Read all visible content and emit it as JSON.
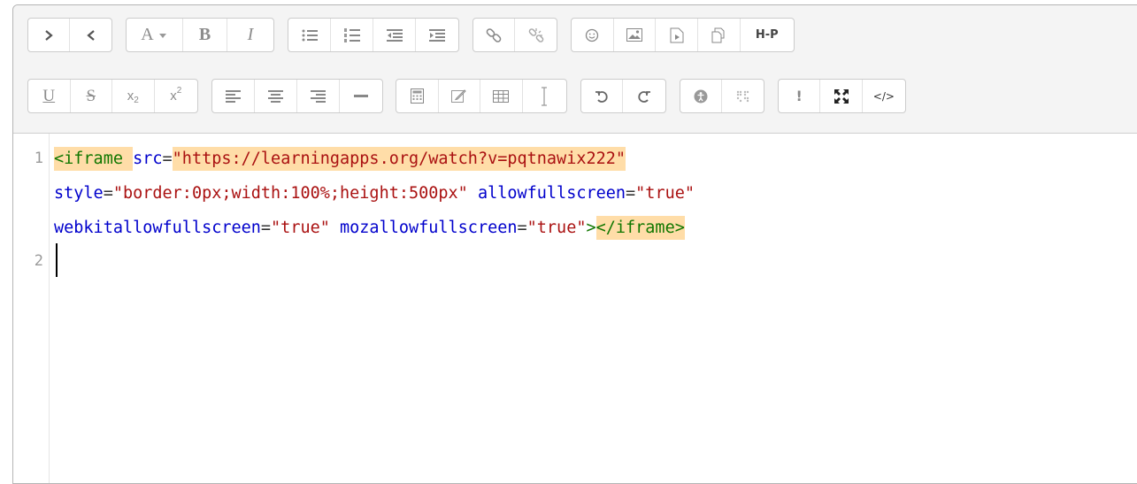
{
  "toolbar": {
    "row1_groups": [
      [
        "chevron-right-icon",
        "chevron-left-icon"
      ],
      [
        "font-icon",
        "bold",
        "italic"
      ],
      [
        "unordered-list-icon",
        "ordered-list-icon",
        "outdent-icon",
        "indent-icon"
      ],
      [
        "link-icon",
        "unlink-icon"
      ],
      [
        "emoji-icon",
        "image-icon",
        "media-icon",
        "manage-files-icon",
        "h5p-icon"
      ]
    ],
    "row2_groups": [
      [
        "underline",
        "strikethrough",
        "subscript",
        "superscript"
      ],
      [
        "align-left-icon",
        "align-center-icon",
        "align-right-icon",
        "horizontal-rule-icon"
      ],
      [
        "equation-icon",
        "edit-icon",
        "table-icon",
        "text-cursor-icon"
      ],
      [
        "undo-icon",
        "redo-icon"
      ],
      [
        "accessibility-checker-icon",
        "screen-reader-helper-icon"
      ],
      [
        "exclamation-icon",
        "fullscreen-icon",
        "html-code-icon"
      ]
    ],
    "labels": {
      "bold": "B",
      "italic": "I",
      "underline": "U",
      "strikethrough": "S",
      "h5p": "H-P",
      "font_letter": "A",
      "subscript_x": "x",
      "subscript_n": "2",
      "superscript_x": "x",
      "superscript_n": "2",
      "html": "</>",
      "exclaim": "!"
    }
  },
  "code": {
    "line_numbers": [
      "1",
      "2"
    ],
    "line1": {
      "tag_open": "<iframe",
      "attr_src": "src",
      "eq": "=",
      "src_value": "\"https://learningapps.org/watch?v=pqtnawix222\""
    },
    "line2": {
      "attr_style": "style",
      "style_value": "\"border:0px;width:100%;height:500px\"",
      "attr_allow": "allowfullscreen",
      "allow_value": "\"true\""
    },
    "line3": {
      "attr_webkit": "webkitallowfullscreen",
      "webkit_value": "\"true\"",
      "attr_moz": "mozallowfullscreen",
      "moz_value": "\"true\"",
      "gt": ">",
      "tag_close": "</iframe>"
    }
  }
}
